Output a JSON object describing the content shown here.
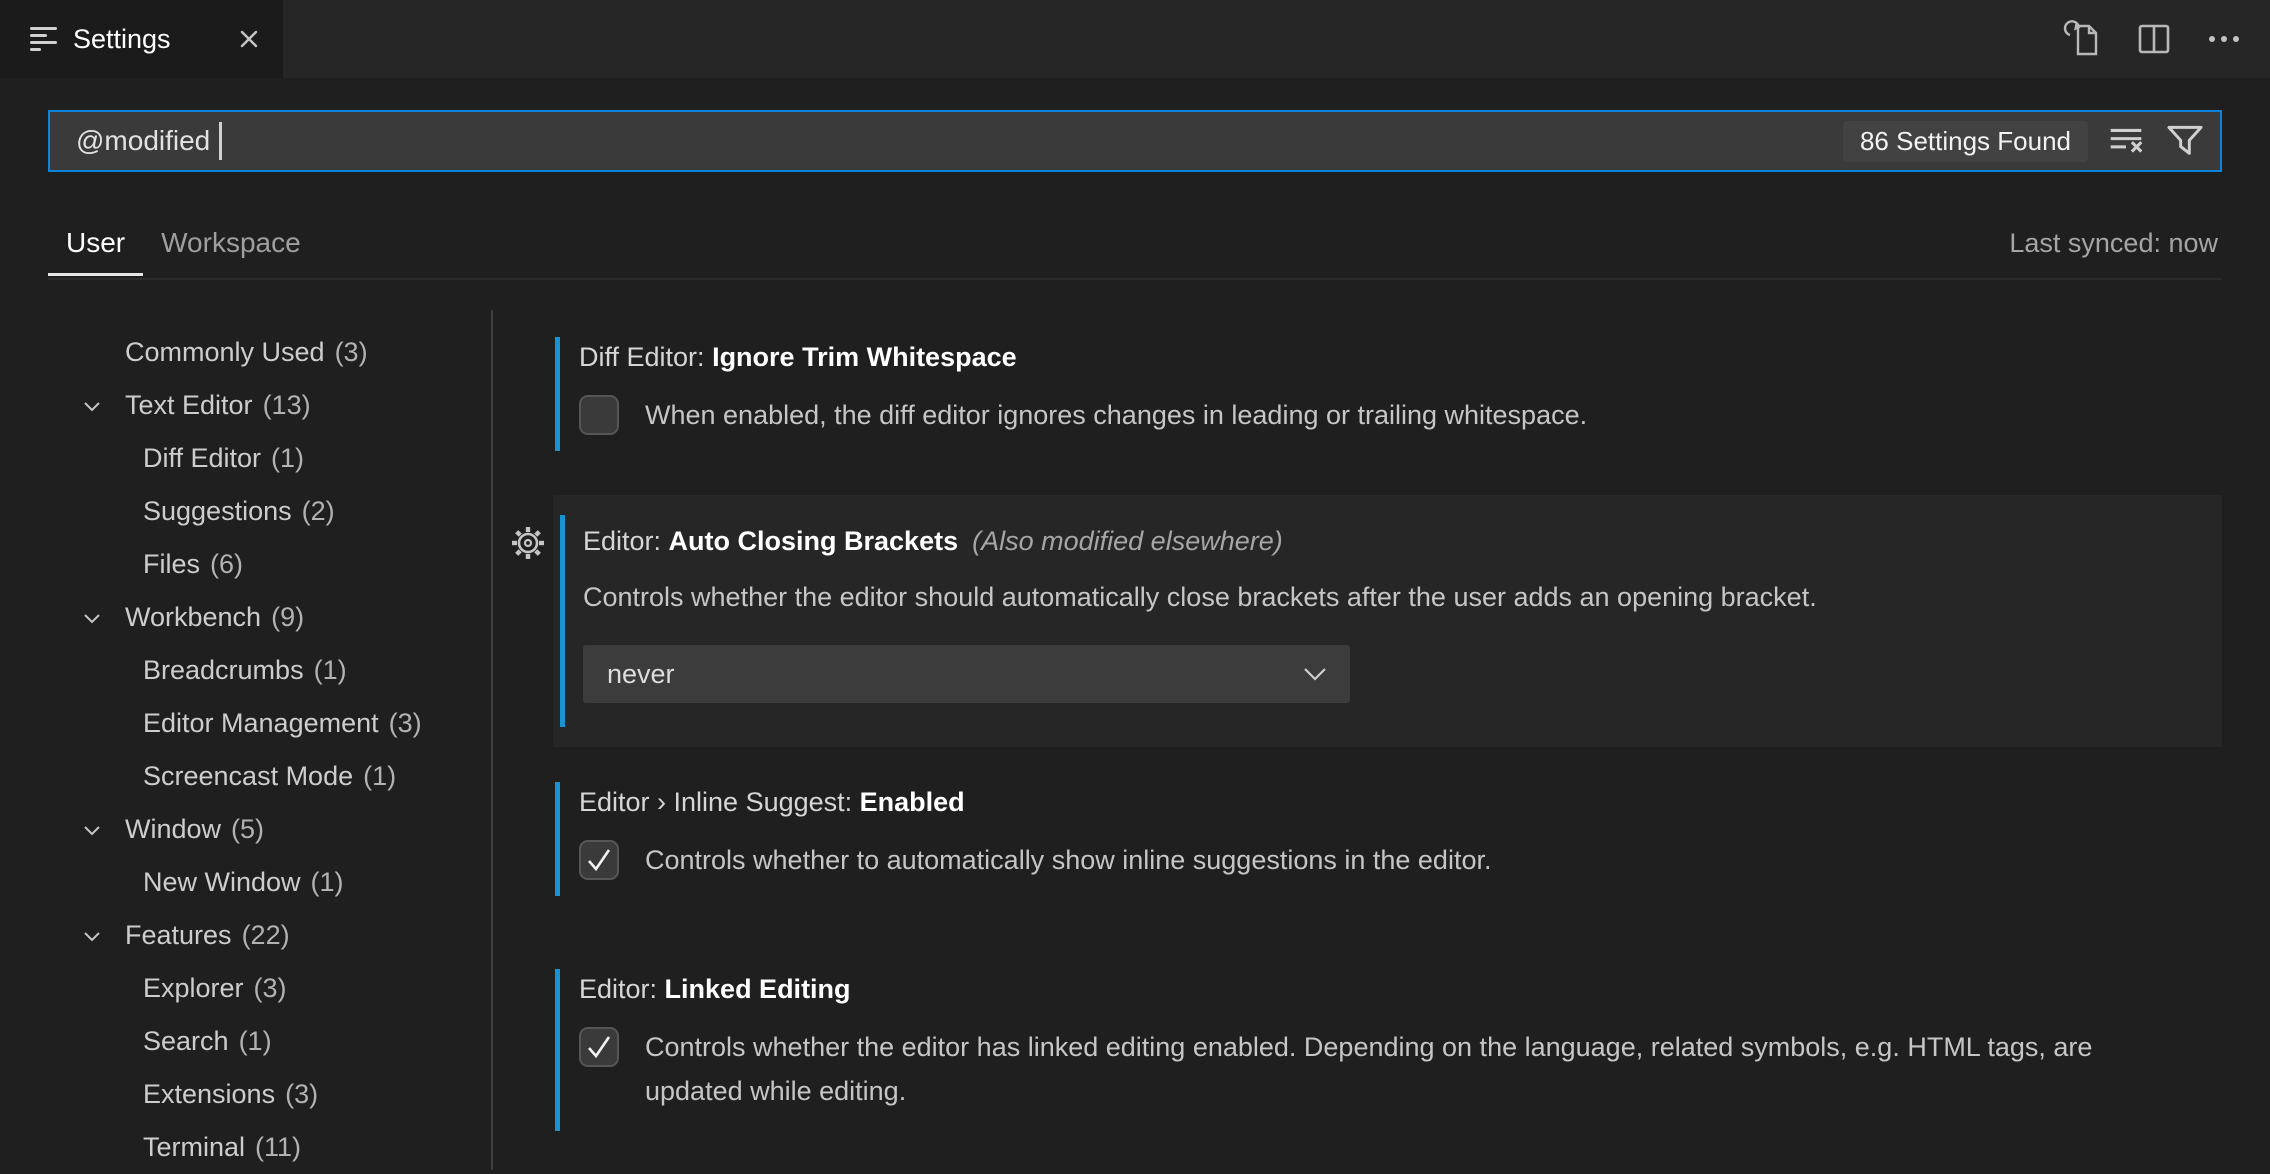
{
  "tab_bar": {
    "tab_label": "Settings",
    "actions": {
      "open_settings_json": "open-settings-json",
      "split_editor": "split-editor",
      "more_actions": "more-actions"
    }
  },
  "search": {
    "value": "@modified",
    "results_count_label": "86 Settings Found"
  },
  "scope": {
    "user_label": "User",
    "workspace_label": "Workspace",
    "last_synced": "Last synced: now"
  },
  "toc": {
    "items": [
      {
        "label": "Commonly Used",
        "count": "(3)"
      },
      {
        "label": "Text Editor",
        "count": "(13)",
        "expanded": true
      },
      {
        "label": "Diff Editor",
        "count": "(1)"
      },
      {
        "label": "Suggestions",
        "count": "(2)"
      },
      {
        "label": "Files",
        "count": "(6)"
      },
      {
        "label": "Workbench",
        "count": "(9)",
        "expanded": true
      },
      {
        "label": "Breadcrumbs",
        "count": "(1)"
      },
      {
        "label": "Editor Management",
        "count": "(3)"
      },
      {
        "label": "Screencast Mode",
        "count": "(1)"
      },
      {
        "label": "Window",
        "count": "(5)",
        "expanded": true
      },
      {
        "label": "New Window",
        "count": "(1)"
      },
      {
        "label": "Features",
        "count": "(22)",
        "expanded": true
      },
      {
        "label": "Explorer",
        "count": "(3)"
      },
      {
        "label": "Search",
        "count": "(1)"
      },
      {
        "label": "Extensions",
        "count": "(3)"
      },
      {
        "label": "Terminal",
        "count": "(11)"
      }
    ]
  },
  "settings": [
    {
      "category": "Diff Editor: ",
      "name": "Ignore Trim Whitespace",
      "description": "When enabled, the diff editor ignores changes in leading or trailing whitespace.",
      "control": "checkbox",
      "checked": false,
      "modified": true
    },
    {
      "category": "Editor: ",
      "name": "Auto Closing Brackets",
      "annotation": "(Also modified elsewhere)",
      "description": "Controls whether the editor should automatically close brackets after the user adds an opening bracket.",
      "control": "select",
      "value": "never",
      "modified": true,
      "highlighted": true
    },
    {
      "category": "Editor › Inline Suggest: ",
      "name": "Enabled",
      "description": "Controls whether to automatically show inline suggestions in the editor.",
      "control": "checkbox",
      "checked": true,
      "modified": true
    },
    {
      "category": "Editor: ",
      "name": "Linked Editing",
      "description": "Controls whether the editor has linked editing enabled. Depending on the language, related symbols, e.g. HTML tags, are updated while editing.",
      "control": "checkbox",
      "checked": true,
      "modified": true
    }
  ],
  "colors": {
    "page_background": "#1f1f1f",
    "tabbar_background": "#262626",
    "active_tab_background": "#1b1b1b",
    "input_background": "#3a3a3a",
    "focus_border": "#0d84d9",
    "modified_indicator": "#1793d2",
    "highlighted_row_background": "#262627"
  }
}
